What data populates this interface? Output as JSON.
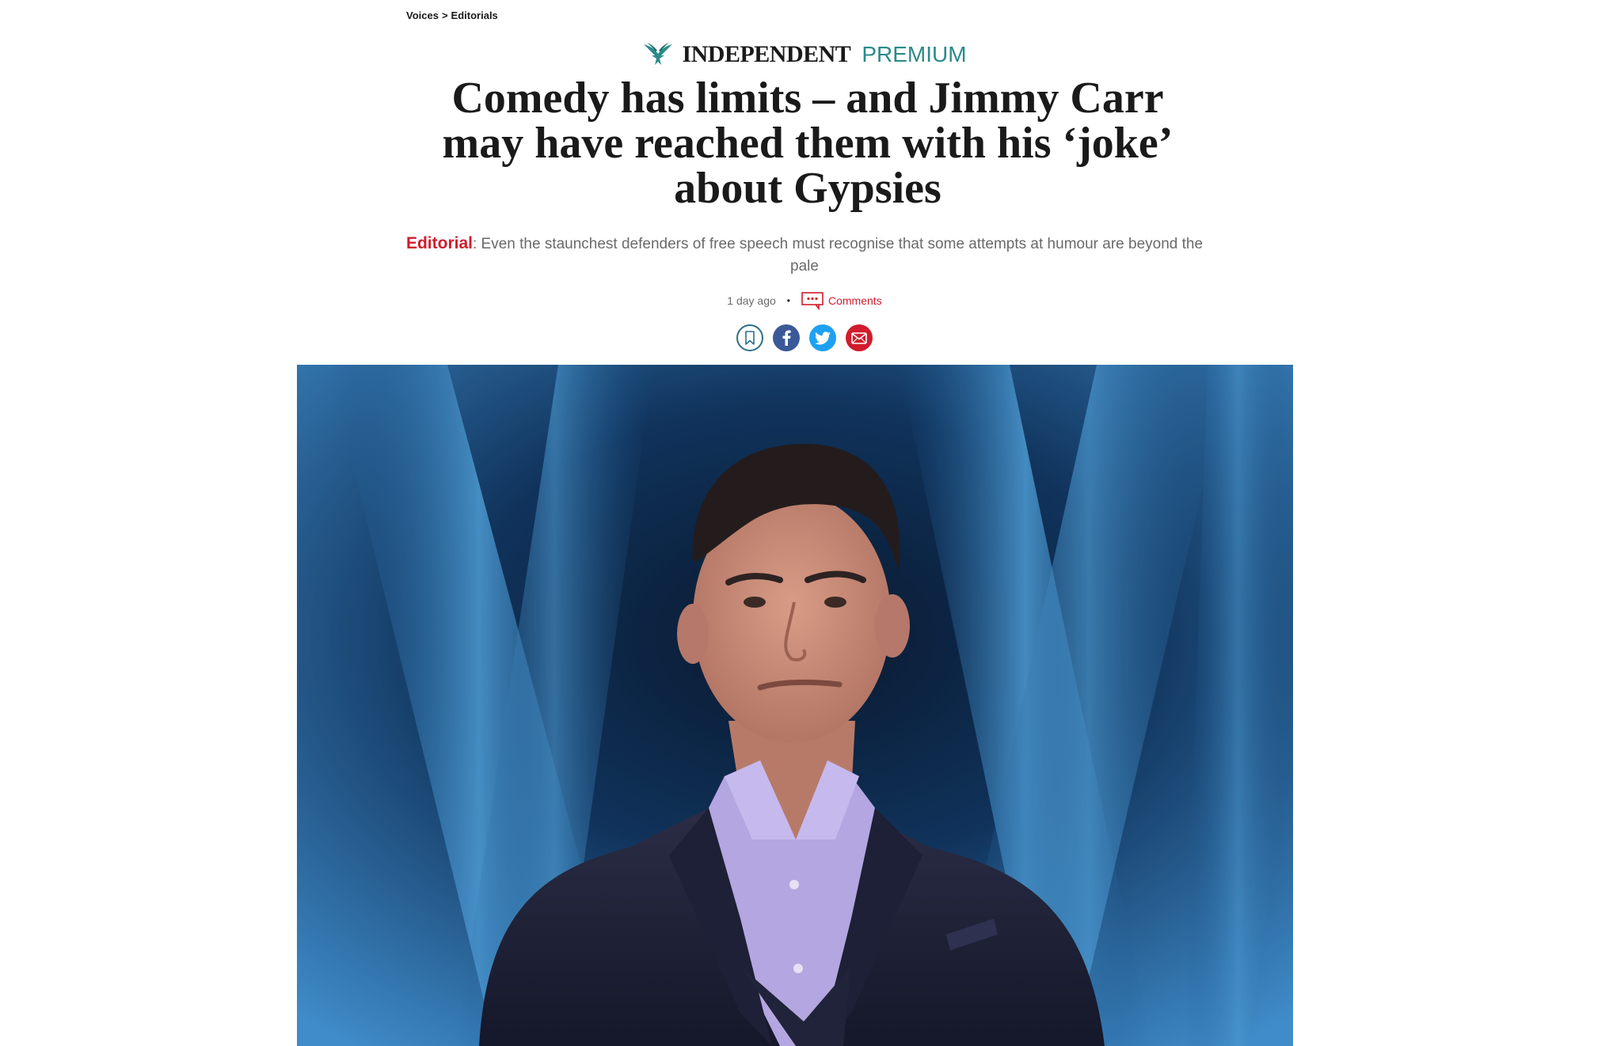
{
  "breadcrumb": {
    "section": "Voices",
    "separator": ">",
    "subsection": "Editorials"
  },
  "masthead": {
    "logo_text": "INDEPENDENT",
    "premium_label": "PREMIUM",
    "premium_color": "#2c8a8a"
  },
  "article": {
    "headline_line1": "Comedy has limits – and Jimmy Carr",
    "headline_line2": "may have reached them with his ‘joke’",
    "headline_line3": "about Gypsies",
    "standfirst_tag": "Editorial",
    "standfirst_text": ": Even the staunchest defenders of free speech must recognise that some attempts at humour are beyond the pale",
    "timestamp": "1 day ago",
    "separator_dot": "•",
    "comments_label": "Comments"
  },
  "share": {
    "buttons": [
      "bookmark-icon",
      "facebook-icon",
      "twitter-icon",
      "email-icon"
    ]
  },
  "colors": {
    "accent_red": "#d01c2c",
    "facebook": "#3b5998",
    "twitter": "#1da1f2",
    "teal": "#2c8a8a"
  }
}
